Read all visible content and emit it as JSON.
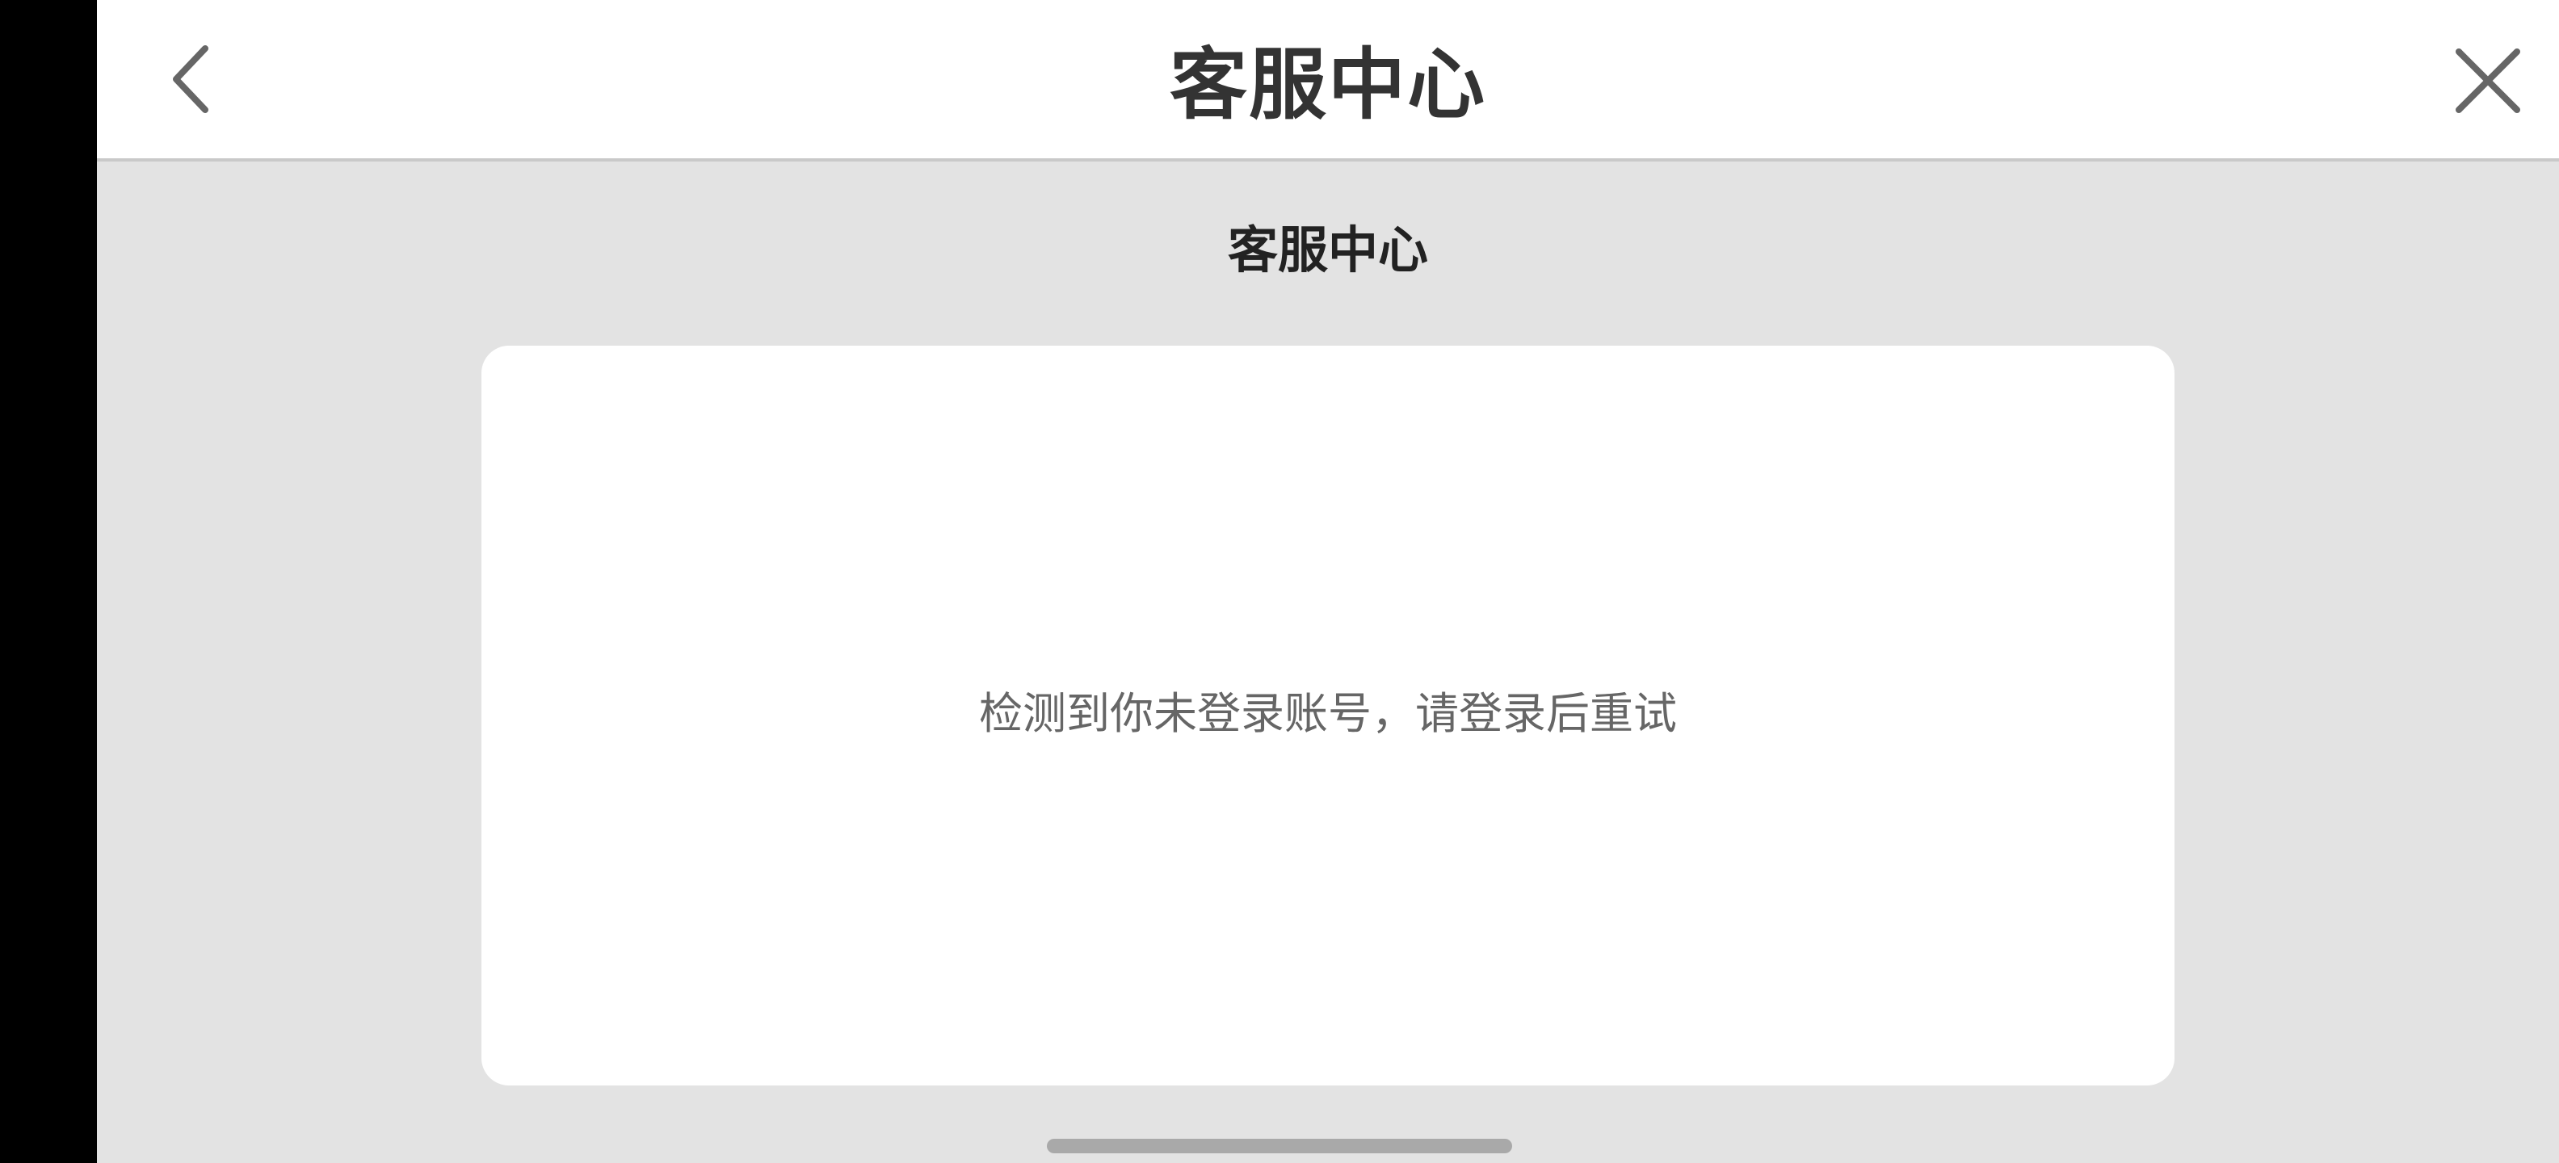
{
  "header": {
    "title": "客服中心",
    "back_icon": "chevron-left-icon",
    "close_icon": "close-icon"
  },
  "main": {
    "section_title": "客服中心",
    "message": "检测到你未登录账号，请登录后重试"
  },
  "colors": {
    "header_bg": "#ffffff",
    "page_bg": "#e3e3e3",
    "card_bg": "#ffffff",
    "title_text": "#333333",
    "message_text": "#666666",
    "home_indicator": "#a9a9a9",
    "left_bar": "#000000"
  }
}
